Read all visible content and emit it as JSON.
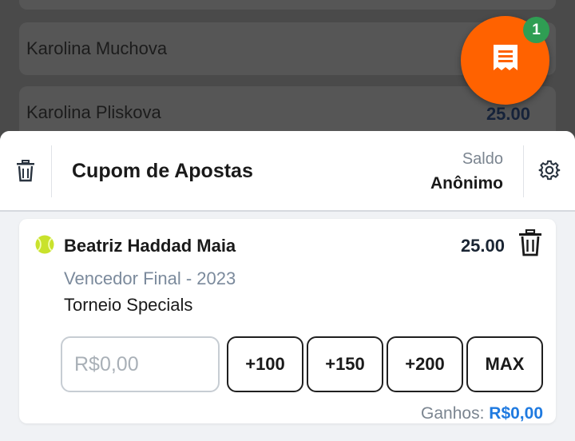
{
  "background_list": {
    "rows": [
      {
        "name": ""
      },
      {
        "name": "Karolina Muchova"
      },
      {
        "name": "Karolina Pliskova",
        "odd": "25.00"
      }
    ]
  },
  "fab": {
    "icon": "receipt-icon",
    "badge": "1"
  },
  "betslip": {
    "title": "Cupom de Apostas",
    "saldo_label": "Saldo",
    "saldo_value": "Anônimo",
    "icons": {
      "delete_all": "trash-icon",
      "settings": "gear-icon"
    }
  },
  "bet": {
    "sport_icon": "tennis-ball-icon",
    "selection": "Beatriz Haddad Maia",
    "odd": "25.00",
    "market": "Vencedor Final - 2023",
    "event": "Torneio Specials",
    "stake_placeholder": "R$0,00",
    "stake_value": "",
    "quick_stakes": [
      "+100",
      "+150",
      "+200",
      "MAX"
    ],
    "winnings_label": "Ganhos:",
    "winnings_value": "R$0,00"
  },
  "colors": {
    "accent_orange": "#ff6200",
    "badge_green": "#2f9e53",
    "winnings_blue": "#1f7ae0"
  }
}
